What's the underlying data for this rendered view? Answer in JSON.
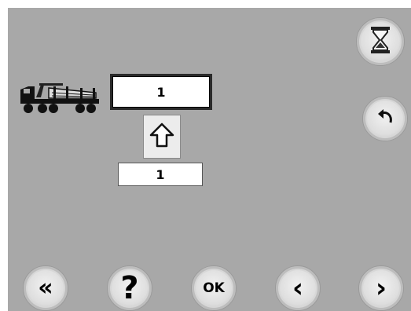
{
  "fields": {
    "top_value": "1",
    "bottom_value": "1"
  },
  "buttons": {
    "ok_label": "OK",
    "help_label": "?",
    "first_label": "«",
    "prev_label": "‹",
    "next_label": "›"
  },
  "icons": {
    "hourglass": "hourglass-icon",
    "undo": "undo-icon",
    "truck": "log-truck-icon",
    "arrow_up": "arrow-up-icon"
  },
  "colors": {
    "background": "#a8a8a8",
    "button_face": "#dedede"
  }
}
